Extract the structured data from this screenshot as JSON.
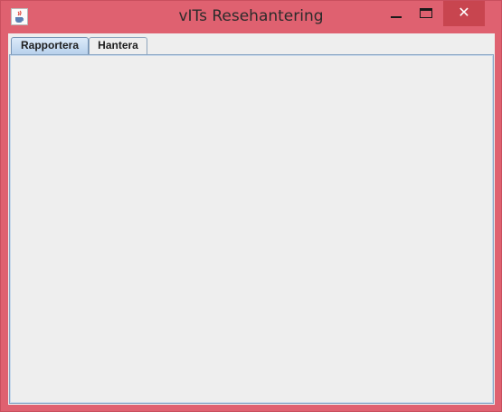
{
  "window": {
    "title": "vITs Resehantering",
    "app_icon": "java-cup-icon",
    "controls": {
      "minimize_icon": "minimize-icon",
      "maximize_icon": "maximize-icon",
      "close_icon": "close-icon",
      "close_glyph": "✕"
    },
    "colors": {
      "frame": "#df6170",
      "close_button": "#c8454f",
      "client_background": "#eeeeee",
      "active_tab": "#b8d1ec"
    }
  },
  "tabs": [
    {
      "label": "Rapportera",
      "selected": true
    },
    {
      "label": "Hantera",
      "selected": false
    }
  ]
}
